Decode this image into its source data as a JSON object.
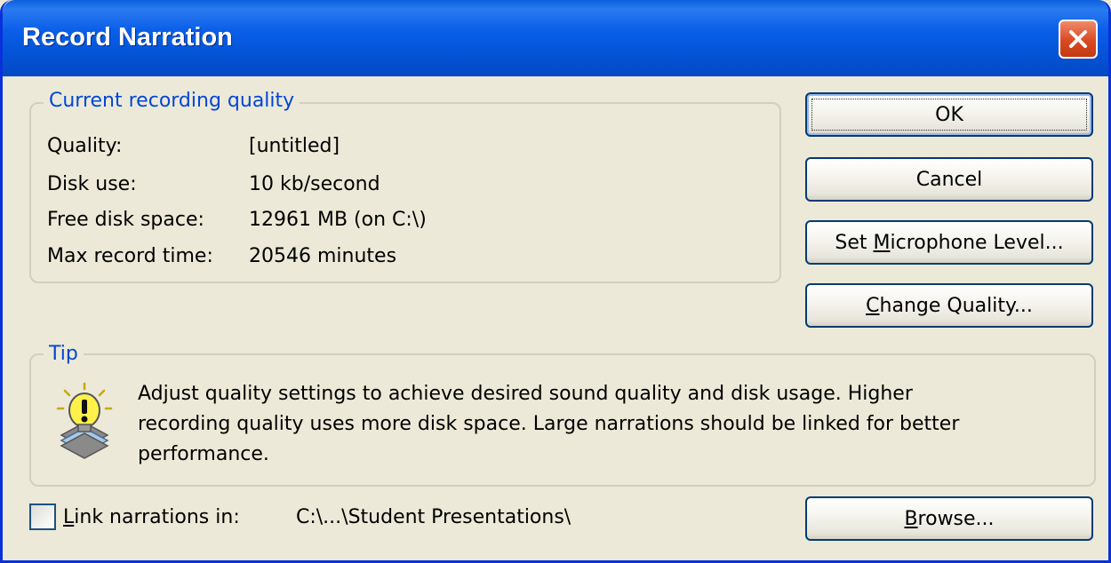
{
  "window": {
    "title": "Record Narration",
    "title_color": "#ffffff",
    "titlebar_color": "#0452d4",
    "close_icon": "close-icon"
  },
  "current_quality": {
    "legend": "Current recording quality",
    "rows": [
      {
        "label": "Quality:",
        "value": "[untitled]"
      },
      {
        "label": "Disk use:",
        "value": "10 kb/second"
      },
      {
        "label": "Free disk space:",
        "value": "12961 MB (on C:\\)"
      },
      {
        "label": "Max record time:",
        "value": "20546 minutes"
      }
    ]
  },
  "buttons": {
    "ok": "OK",
    "cancel": "Cancel",
    "set_mic_level": {
      "pre": "Set ",
      "key": "M",
      "post": "icrophone Level..."
    },
    "change_quality": {
      "pre": "",
      "key": "C",
      "post": "hange Quality..."
    },
    "browse": {
      "pre": "",
      "key": "B",
      "post": "rowse..."
    }
  },
  "tip": {
    "legend": "Tip",
    "icon": "lightbulb-icon",
    "lines": [
      "Adjust quality settings to achieve desired sound quality and disk usage. Higher",
      "recording quality uses more disk space. Large narrations should be linked for better",
      "performance."
    ]
  },
  "link": {
    "checked": false,
    "label_key": "L",
    "label_rest": "ink narrations in:",
    "path": "C:\\...\\Student Presentations\\"
  },
  "colors": {
    "legend": "#0046d5",
    "background": "#ece9d8",
    "button_border": "#003c74"
  }
}
